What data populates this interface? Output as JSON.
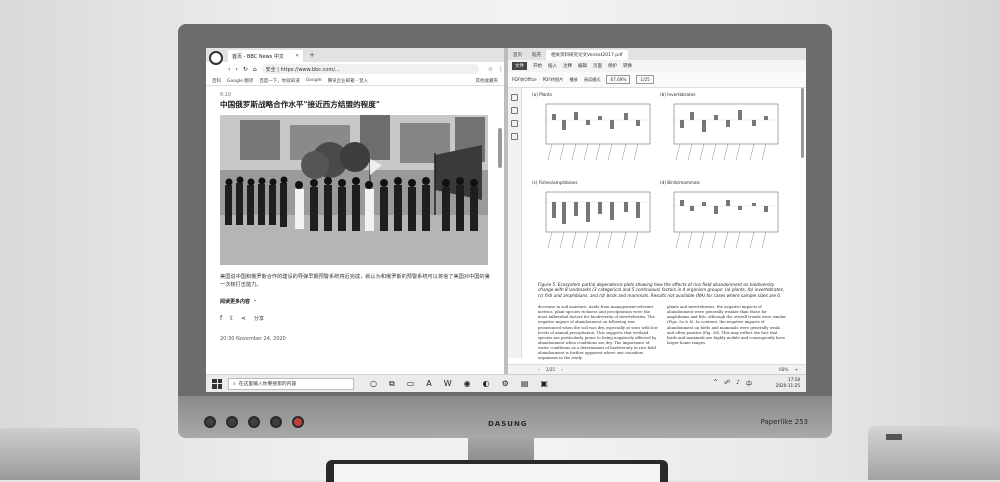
{
  "monitor": {
    "brand": "DASUNG",
    "model": "Paperlike 253"
  },
  "browser": {
    "tab_title": "首页 - BBC News 中文",
    "url": "安全 | https://www.bbc.com/...",
    "bookmarks": [
      "百科",
      "Google 翻译",
      "百度一下，你就知道",
      "Google",
      "腾讯企业邮箱 - 登入"
    ],
    "bookmarks_right": "其他收藏夹",
    "article": {
      "time": "6:10",
      "headline": "中国俄罗斯战略合作水平\"接近西方结盟的程度\"",
      "caption": "美国说中国和俄罗斯合作的建设的导弹早期预警系统将近完成，就认为和俄罗斯的预警系统可以将信了美国对中国的第一次核打击能力。",
      "read_more": "阅读更多内容",
      "share_label": "分享",
      "date": "20:30 November 24, 2020"
    }
  },
  "pdf": {
    "tabs": [
      "首页",
      "稻壳",
      "相关资料研究论文Venkat2017.pdf"
    ],
    "menu": [
      "开始",
      "插入",
      "注释",
      "编辑",
      "页面",
      "保护",
      "转换"
    ],
    "menu_highlight": "文件",
    "tools": [
      "PDF转Office",
      "PDF转图片",
      "播放",
      "阅读模式"
    ],
    "zoom": "67.69%",
    "page_num": "1/25",
    "panels": [
      {
        "id": "a",
        "title": "(a) Plants"
      },
      {
        "id": "b",
        "title": "(b) Invertebrates"
      },
      {
        "id": "c",
        "title": "(c) Fishes/amphibians"
      },
      {
        "id": "d",
        "title": "(d) Birds/mammals"
      }
    ],
    "figure_caption": "Figure 5. Ecosystem partial dependence plots showing how the effects of rice field abandonment on biodiversity change with 8 landmarks (3 categorical and 5 continuous) factors in 4 organism groups: (a) plants, (b) invertebrates, (c) fish and amphibians, and (d) birds and mammals. Results not available (NA) for cases where sample sizes are 0.",
    "body_left": "decrease in soil moisture. Aside from management-relevant metrics, plant species richness and precipitation were the most influential factors for biodiversity of invertebrates. The negative impact of abandonment on following was pronounced when the soil was dry, especially at sites with low levels of annual precipitation. This suggests that wetland species are particularly prone to being negatively affected by abandonment when conditions are dry.",
    "body_left2": "The importance of water conditions as a determinant of biodiversity in rice field abandonment is further apparent where one considers organisms in the study.",
    "body_right": "plants and invertebrates, the negative impacts of abandonment were generally weaker than those for amphibians and fish, although the overall trends were similar (Figs. 5a & b). In contrast, the negative impacts of abandonment on birds and mammals were generally weak and often positive (Fig. 5d). This may reflect the fact that birds and mammals are highly mobile and consequently have larger home ranges.",
    "status_page": "1/25",
    "status_zoom": "68%"
  },
  "taskbar": {
    "search_placeholder": "在这里输入你要搜索的内容",
    "time": "17:18",
    "date": "2020-11-25"
  }
}
